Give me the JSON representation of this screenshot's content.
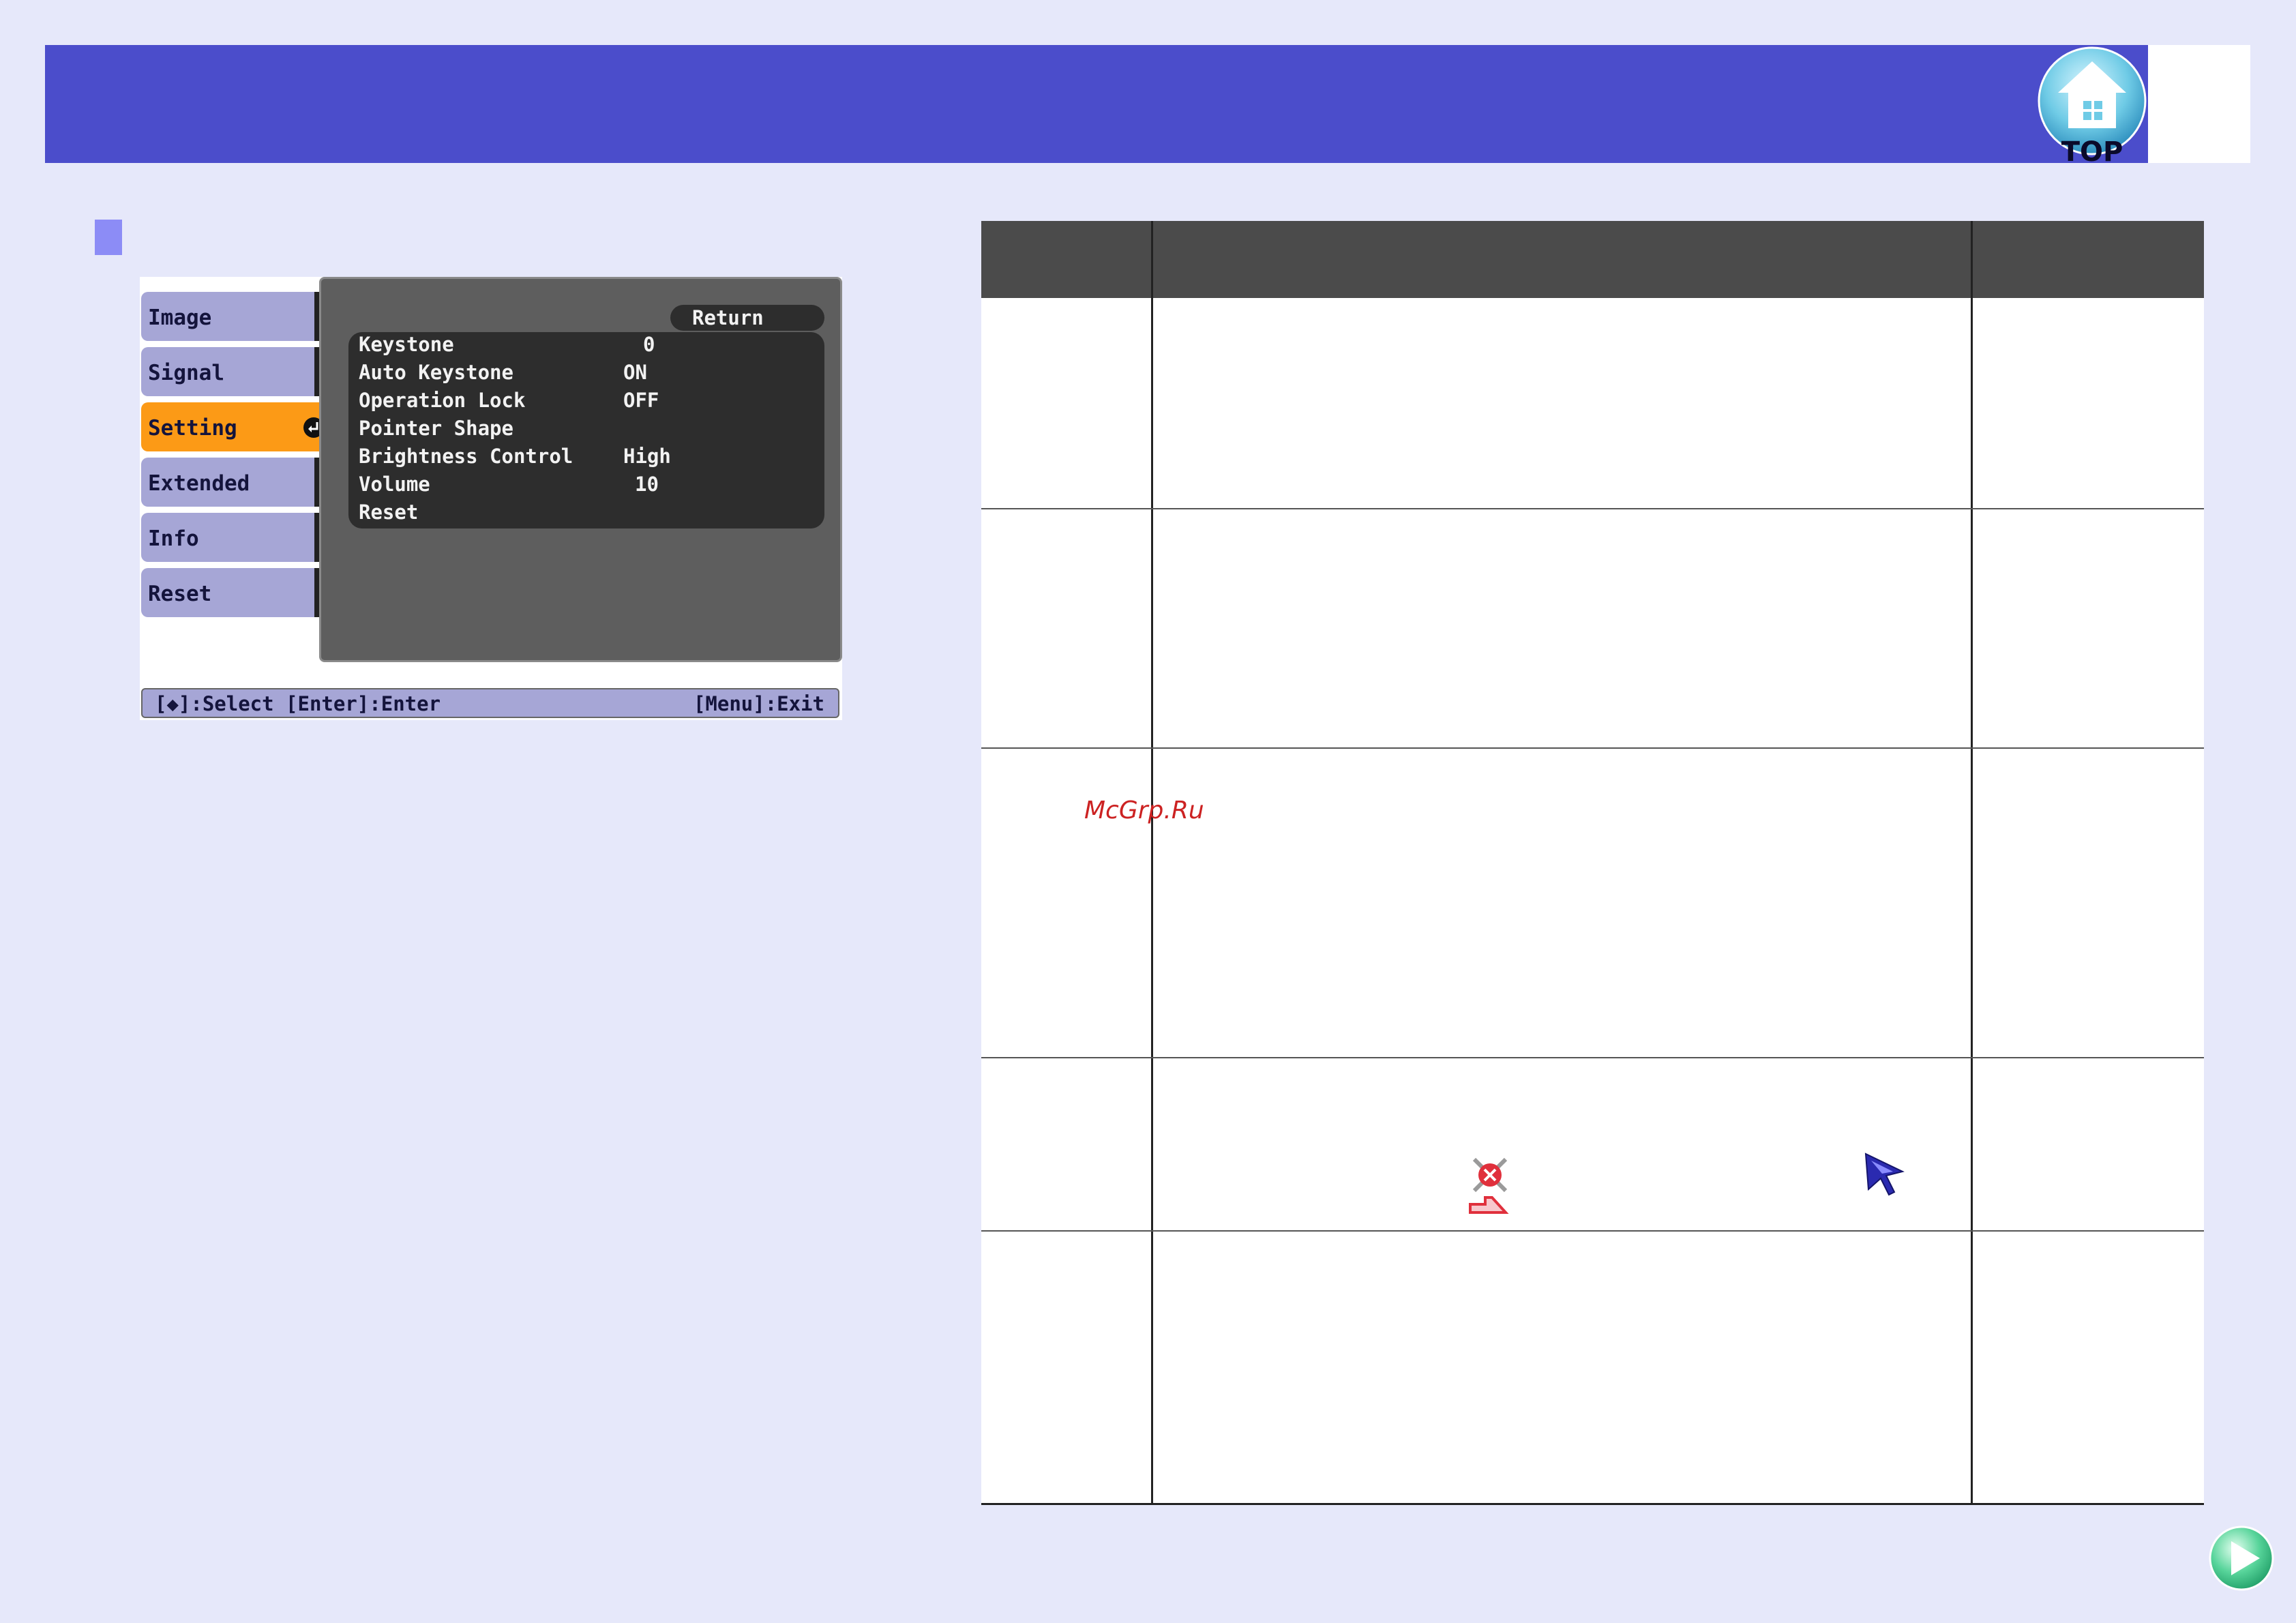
{
  "header": {
    "top_button_label": "TOP"
  },
  "menu": {
    "tabs": [
      {
        "label": "Image"
      },
      {
        "label": "Signal"
      },
      {
        "label": "Setting"
      },
      {
        "label": "Extended"
      },
      {
        "label": "Info"
      },
      {
        "label": "Reset"
      }
    ],
    "active_tab": "Setting",
    "return_label": "Return",
    "items": [
      {
        "label": "Keystone",
        "value": "0"
      },
      {
        "label": "Auto Keystone",
        "value": "ON"
      },
      {
        "label": "Operation Lock",
        "value": "OFF"
      },
      {
        "label": "Pointer Shape",
        "value": ""
      },
      {
        "label": "Brightness Control",
        "value": "High"
      },
      {
        "label": "Volume",
        "value": "10"
      },
      {
        "label": "Reset",
        "value": ""
      }
    ],
    "footer_left": "[◆]:Select [Enter]:Enter",
    "footer_right": "[Menu]:Exit"
  },
  "watermark": "McGrp.Ru",
  "colors": {
    "header": "#4b4dcb",
    "background": "#e6e8fa",
    "active_tab": "#fc9a16",
    "tab": "#a6a6d6",
    "table_header": "#4b4b4b"
  },
  "icons": [
    "home-top-icon",
    "enter-icon",
    "pointer-shape-1-icon",
    "pointer-shape-2-icon",
    "next-page-arrow-icon"
  ]
}
